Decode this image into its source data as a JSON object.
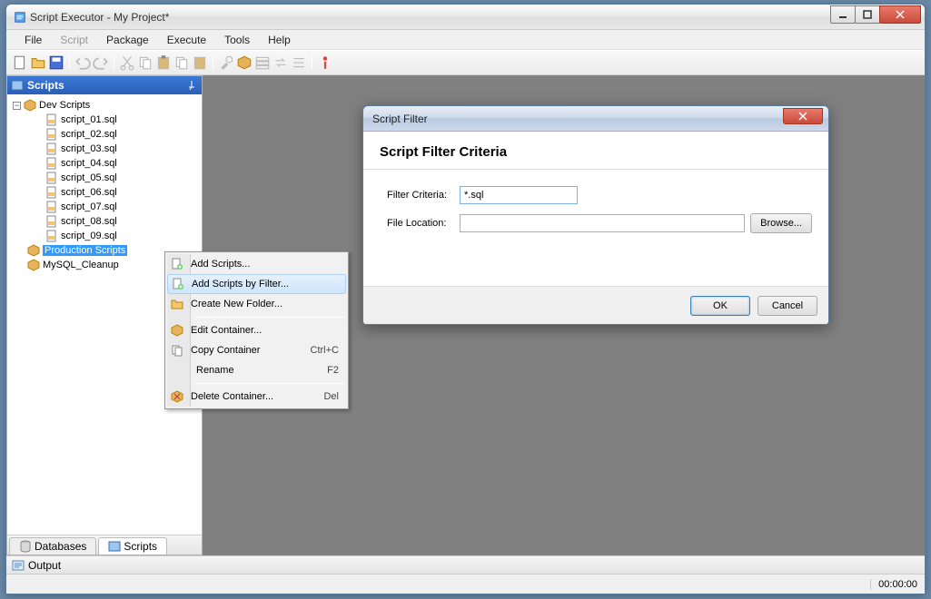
{
  "window": {
    "title": "Script Executor - My Project*"
  },
  "menu": {
    "file": "File",
    "script": "Script",
    "package": "Package",
    "execute": "Execute",
    "tools": "Tools",
    "help": "Help"
  },
  "sidebar": {
    "title": "Scripts",
    "root": "Dev Scripts",
    "scripts": [
      "script_01.sql",
      "script_02.sql",
      "script_03.sql",
      "script_04.sql",
      "script_05.sql",
      "script_06.sql",
      "script_07.sql",
      "script_08.sql",
      "script_09.sql"
    ],
    "production": "Production Scripts",
    "cleanup": "MySQL_Cleanup",
    "tabs": {
      "databases": "Databases",
      "scripts": "Scripts"
    }
  },
  "context_menu": {
    "add_scripts": "Add Scripts...",
    "add_by_filter": "Add Scripts by Filter...",
    "create_folder": "Create New Folder...",
    "edit_container": "Edit Container...",
    "copy_container": "Copy Container",
    "copy_shortcut": "Ctrl+C",
    "rename": "Rename",
    "rename_shortcut": "F2",
    "delete_container": "Delete Container...",
    "delete_shortcut": "Del"
  },
  "dialog": {
    "title": "Script Filter",
    "header": "Script Filter Criteria",
    "filter_criteria_label": "Filter Criteria:",
    "filter_criteria_value": "*.sql",
    "file_location_label": "File Location:",
    "file_location_value": "",
    "browse": "Browse...",
    "ok": "OK",
    "cancel": "Cancel"
  },
  "output": {
    "label": "Output"
  },
  "status": {
    "time": "00:00:00"
  }
}
